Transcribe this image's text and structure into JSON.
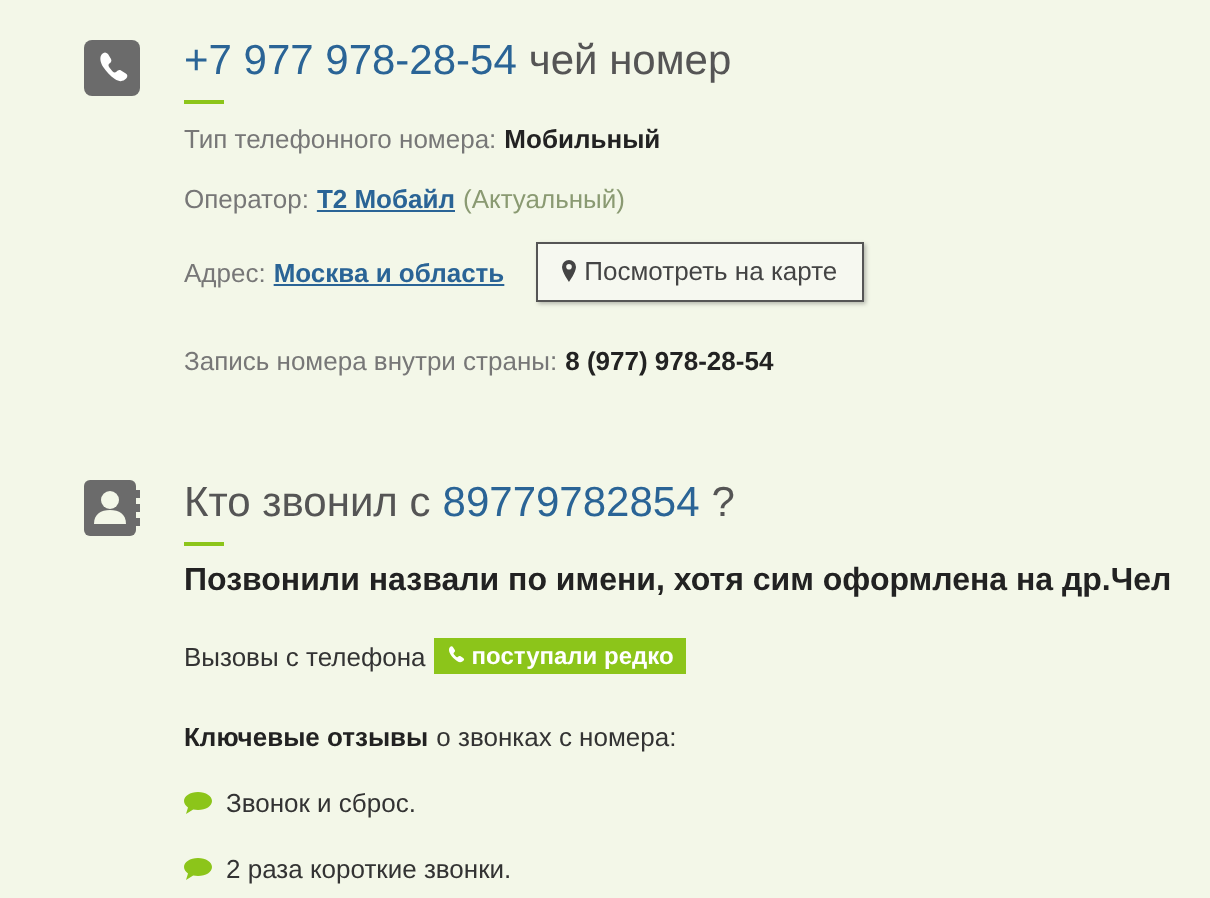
{
  "number_section": {
    "number": "+7 977 978-28-54",
    "title_suffix": "чей номер",
    "type": {
      "label": "Тип телефонного номера:",
      "value": "Мобильный"
    },
    "operator": {
      "label": "Оператор:",
      "link": "Т2 Мобайл",
      "status": "(Актуальный)"
    },
    "address": {
      "label": "Адрес:",
      "link": "Москва и область",
      "button": "Посмотреть на карте"
    },
    "domestic": {
      "label": "Запись номера внутри страны:",
      "value": "8 (977) 978-28-54"
    }
  },
  "callers_section": {
    "title_prefix": "Кто звонил с",
    "number": "89779782854",
    "title_suffix": "?",
    "headline": "Позвонили назвали по имени, хотя сим оформлена на др.Чел",
    "calls": {
      "label": "Вызовы с телефона",
      "badge": "поступали редко"
    },
    "reviews_intro": "**Ключевые отзывы** о звонках с номера:",
    "reviews": [
      {
        "text": "Звонок и сброс."
      },
      {
        "text": "2 раза короткие звонки."
      }
    ]
  }
}
